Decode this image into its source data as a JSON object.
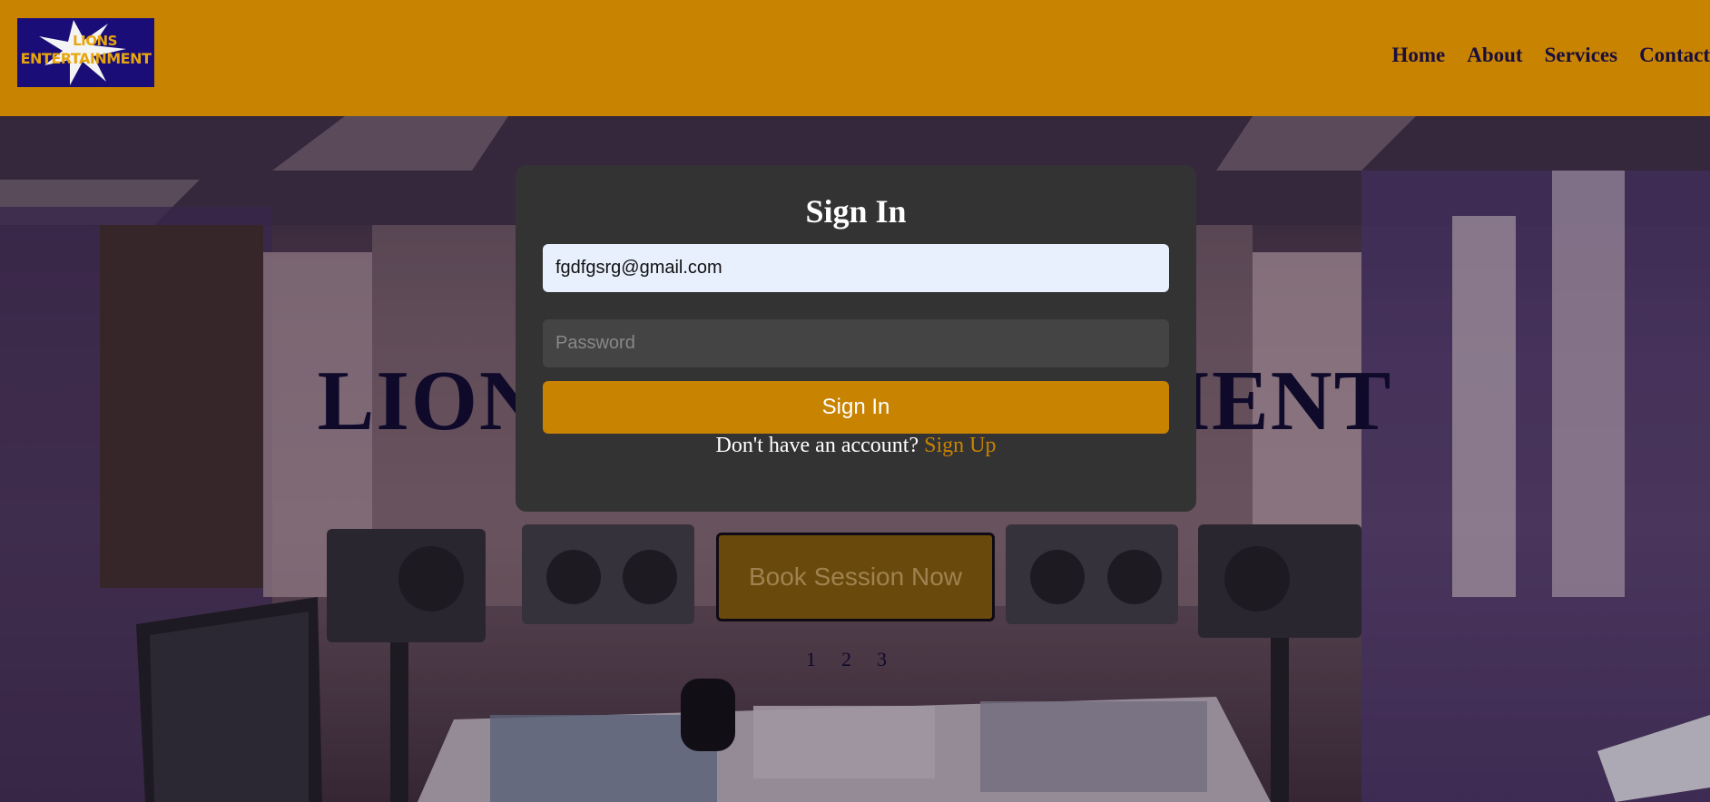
{
  "header": {
    "logo": {
      "line1": "LIONS",
      "line2": "ENTERTAINMENT"
    },
    "nav": [
      {
        "label": "Home"
      },
      {
        "label": "About"
      },
      {
        "label": "Services"
      },
      {
        "label": "Contact"
      }
    ],
    "bg_color": "#c88300"
  },
  "hero": {
    "title": "LIONS ENTERTAINMENT",
    "book_button": "Book Session Now",
    "pager": [
      "1",
      "2",
      "3"
    ]
  },
  "signin_modal": {
    "title": "Sign In",
    "email": {
      "value": "fgdfgsrg@gmail.com"
    },
    "password": {
      "placeholder": "Password"
    },
    "submit_label": "Sign In",
    "signup_prompt": "Don't have an account?",
    "signup_link": "Sign Up"
  },
  "colors": {
    "accent": "#c88300",
    "modal_bg": "#333333",
    "logo_bg": "#1b0d78"
  }
}
